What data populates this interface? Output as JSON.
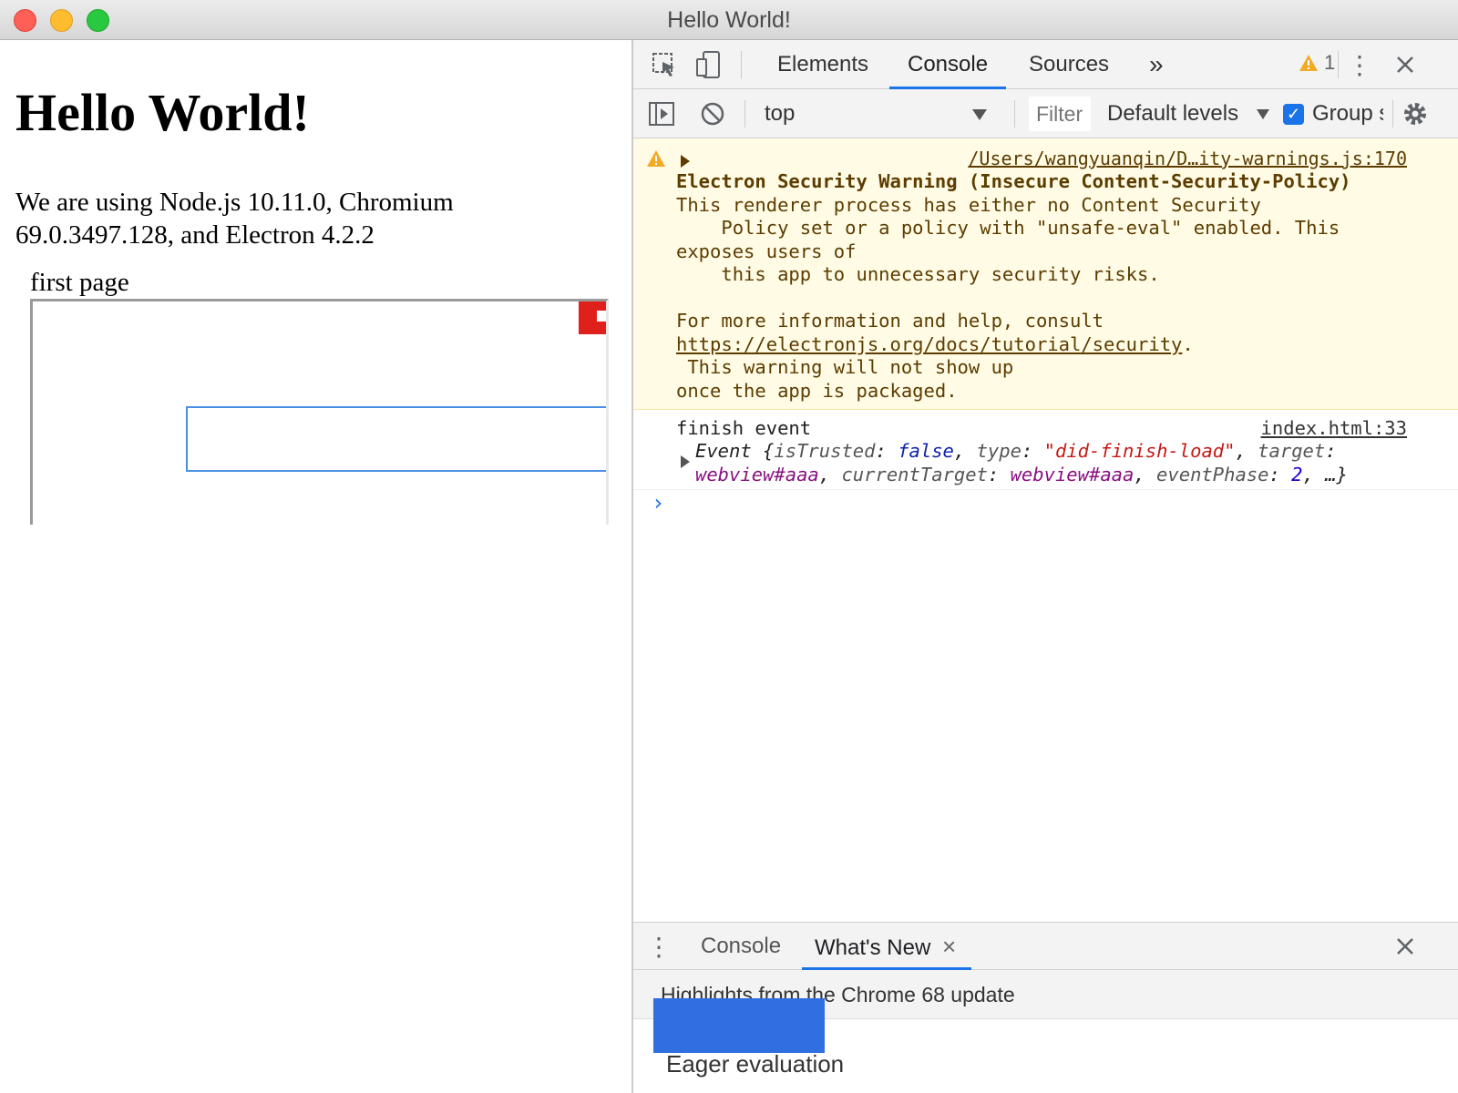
{
  "window": {
    "title": "Hello World!"
  },
  "page": {
    "heading": "Hello World!",
    "paragraph": "We are using Node.js 10.11.0, Chromium 69.0.3497.128, and Electron 4.2.2",
    "webview_label": "first page"
  },
  "devtools": {
    "tabs": [
      {
        "label": "Elements",
        "active": false
      },
      {
        "label": "Console",
        "active": true
      },
      {
        "label": "Sources",
        "active": false
      }
    ],
    "more_tabs_glyph": "»",
    "warning_count": "1",
    "context": "top",
    "filter_placeholder": "Filter",
    "levels": "Default levels",
    "group_label": "Group similar",
    "messages": {
      "warning": {
        "source": "/Users/wangyuanqin/D…ity-warnings.js:170",
        "title": "Electron Security Warning (Insecure Content-Security-Policy)",
        "line1": "This renderer process has either no Content Security",
        "line2": "    Policy set or a policy with \"unsafe-eval\" enabled. This",
        "line3": "exposes users of",
        "line4": "    this app to unnecessary security risks.",
        "line5": "For more information and help, consult",
        "link": "https://electronjs.org/docs/tutorial/security",
        "link_suffix": ".",
        "line6": " This warning will not show up",
        "line7": "once the app is packaged."
      },
      "log": {
        "text": "finish event",
        "source": "index.html:33",
        "object": {
          "prefix": "Event {",
          "k1": "isTrusted",
          "v1": "false",
          "k2": "type",
          "v2": "\"did-finish-load\"",
          "k3": "target",
          "v3": "webview#aaa",
          "k4": "currentTarget",
          "v4": "webview#aaa",
          "k5": "eventPhase",
          "v5": "2",
          "suffix": "…}"
        }
      }
    },
    "prompt": "›",
    "drawer": {
      "tabs": [
        {
          "label": "Console",
          "active": false
        },
        {
          "label": "What's New",
          "active": true
        }
      ],
      "close_tab_glyph": "×",
      "highlights": "Highlights from the Chrome 68 update",
      "section_title": "Eager evaluation"
    },
    "colors": {
      "accent": "#1a73e8",
      "warning_bg": "#fffbe5",
      "warning_text": "#5c3c00"
    }
  }
}
